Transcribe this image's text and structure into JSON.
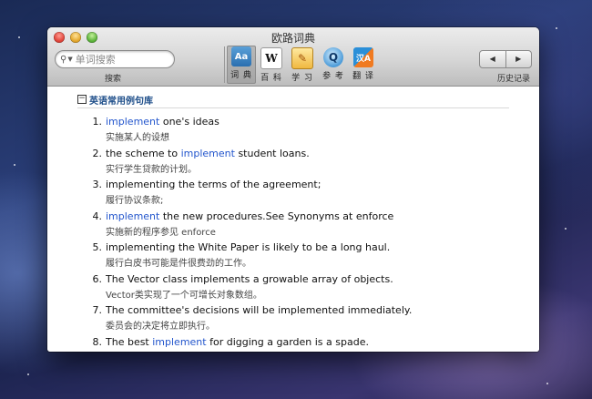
{
  "window": {
    "title": "欧路词典"
  },
  "search": {
    "placeholder": "单词搜索",
    "label": "搜索"
  },
  "toolbar": {
    "tools": [
      {
        "label": "词 典",
        "icon": "dictionary-icon",
        "glyph": "Aa"
      },
      {
        "label": "百 科",
        "icon": "wikipedia-icon",
        "glyph": "W"
      },
      {
        "label": "学 习",
        "icon": "learn-icon",
        "glyph": "✎"
      },
      {
        "label": "参 考",
        "icon": "reference-icon",
        "glyph": "Q"
      },
      {
        "label": "翻 译",
        "icon": "translate-icon",
        "glyph": "汉A"
      }
    ],
    "history": {
      "back": "◀",
      "forward": "▶",
      "label": "历史记录"
    }
  },
  "section": {
    "collapse": "−",
    "title": "英语常用例句库"
  },
  "examples": [
    {
      "num": "1.",
      "pre": "",
      "hl": "implement",
      "post": " one's ideas",
      "zh": "实施某人的设想"
    },
    {
      "num": "2.",
      "pre": "the scheme to ",
      "hl": "implement",
      "post": " student loans.",
      "zh": "实行学生贷款的计划。"
    },
    {
      "num": "3.",
      "pre": "implementing the terms of the agreement;",
      "hl": "",
      "post": "",
      "zh": "履行协议条款;"
    },
    {
      "num": "4.",
      "pre": "",
      "hl": "implement",
      "post": " the new procedures.See Synonyms at enforce",
      "zh": "实施新的程序参见 enforce"
    },
    {
      "num": "5.",
      "pre": "implementing the White Paper is likely to be a long haul.",
      "hl": "",
      "post": "",
      "zh": "履行白皮书可能是件很费劲的工作。"
    },
    {
      "num": "6.",
      "pre": "The Vector class implements a growable array of objects.",
      "hl": "",
      "post": "",
      "zh": "Vector类实现了一个可增长对象数组。"
    },
    {
      "num": "7.",
      "pre": "The committee's decisions will be implemented immediately.",
      "hl": "",
      "post": "",
      "zh": "委员会的决定将立即执行。"
    },
    {
      "num": "8.",
      "pre": "The best ",
      "hl": "implement",
      "post": " for digging a garden is a spade.",
      "zh": ""
    }
  ]
}
